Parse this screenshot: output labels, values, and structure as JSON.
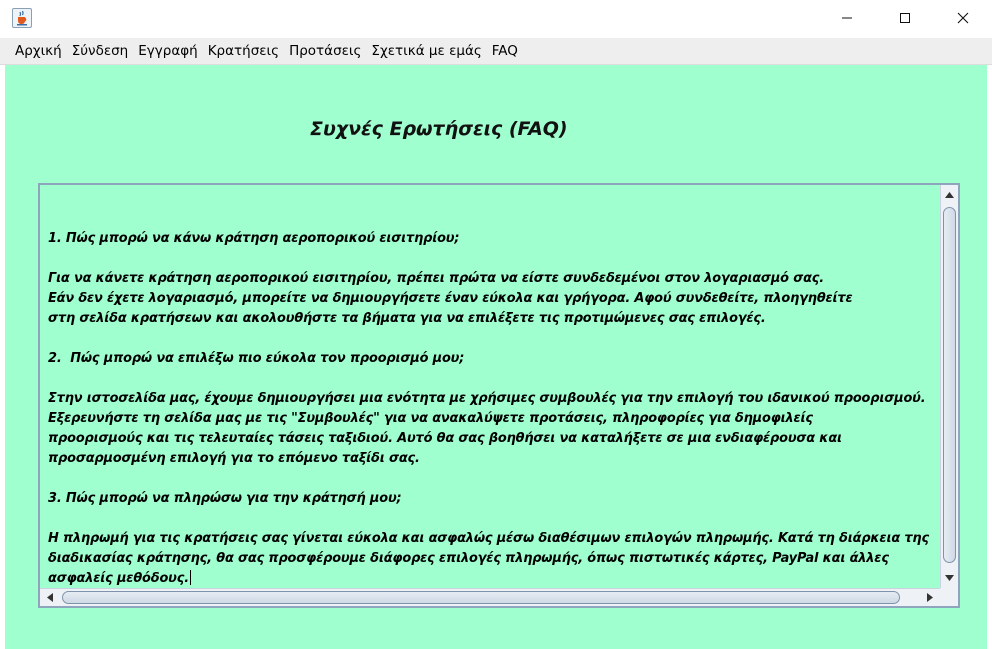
{
  "window": {
    "icon": "java-cup-icon",
    "controls": [
      "minimize-icon",
      "maximize-icon",
      "close-icon"
    ]
  },
  "menu": {
    "items": [
      "Αρχική",
      "Σύνδεση",
      "Εγγραφή",
      "Κρατήσεις",
      "Προτάσεις",
      "Σχετικά με εμάς",
      "FAQ"
    ]
  },
  "page": {
    "title": "Συχνές Ερωτήσεις (FAQ)",
    "background": "#9fffcf"
  },
  "faq_text": {
    "lines": [
      "1. Πώς μπορώ να κάνω κράτηση αεροπορικού εισιτηρίου;",
      "",
      "Για να κάνετε κράτηση αεροπορικού εισιτηρίου, πρέπει πρώτα να είστε συνδεδεμένοι στον λογαριασμό σας.",
      "Εάν δεν έχετε λογαριασμό, μπορείτε να δημιουργήσετε έναν εύκολα και γρήγορα. Αφού συνδεθείτε, πλοηγηθείτε",
      "στη σελίδα κρατήσεων και ακολουθήστε τα βήματα για να επιλέξετε τις προτιμώμενες σας επιλογές.",
      "",
      "2.  Πώς μπορώ να επιλέξω πιο εύκολα τον προορισμό μου;",
      "",
      "Στην ιστοσελίδα μας, έχουμε δημιουργήσει μια ενότητα με χρήσιμες συμβουλές για την επιλογή του ιδανικού προορισμού.",
      "Εξερευνήστε τη σελίδα μας με τις \"Συμβουλές\" για να ανακαλύψετε προτάσεις, πληροφορίες για δημοφιλείς",
      "προορισμούς και τις τελευταίες τάσεις ταξιδιού. Αυτό θα σας βοηθήσει να καταλήξετε σε μια ενδιαφέρουσα και",
      "προσαρμοσμένη επιλογή για το επόμενο ταξίδι σας.",
      "",
      "3. Πώς μπορώ να πληρώσω για την κράτησή μου;",
      "",
      "Η πληρωμή για τις κρατήσεις σας γίνεται εύκολα και ασφαλώς μέσω διαθέσιμων επιλογών πληρωμής. Κατά τη διάρκεια της",
      "διαδικασίας κράτησης, θα σας προσφέρουμε διάφορες επιλογές πληρωμής, όπως πιστωτικές κάρτες, PayPal και άλλες",
      "ασφαλείς μεθόδους."
    ]
  }
}
